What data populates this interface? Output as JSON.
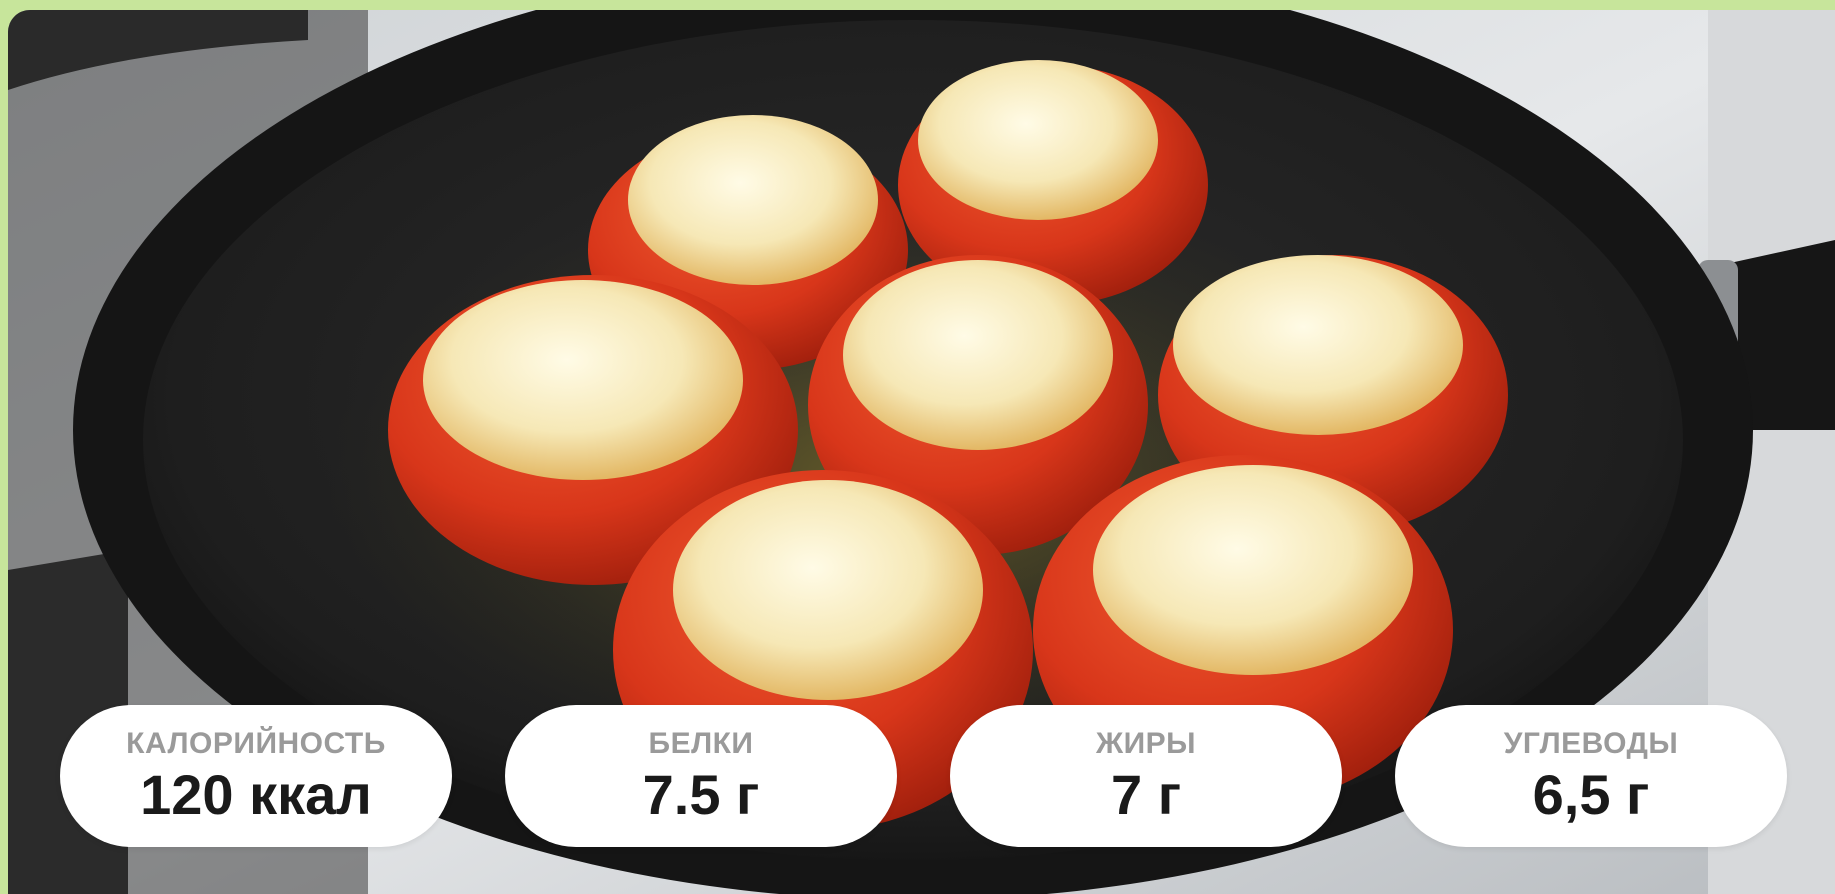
{
  "nutrition": {
    "calories": {
      "label": "КАЛОРИЙНОСТЬ",
      "value": "120 ккал"
    },
    "protein": {
      "label": "БЕЛКИ",
      "value": "7.5 г"
    },
    "fat": {
      "label": "ЖИРЫ",
      "value": "7 г"
    },
    "carbs": {
      "label": "УГЛЕВОДЫ",
      "value": "6,5 г"
    }
  },
  "colors": {
    "border": "#c7e59b",
    "pan": "#232323",
    "tomato": "#d63a1e",
    "cheese": "#f4e7b8",
    "card": "#ffffff",
    "label": "#9a9a9a",
    "value": "#1a1a1a"
  }
}
